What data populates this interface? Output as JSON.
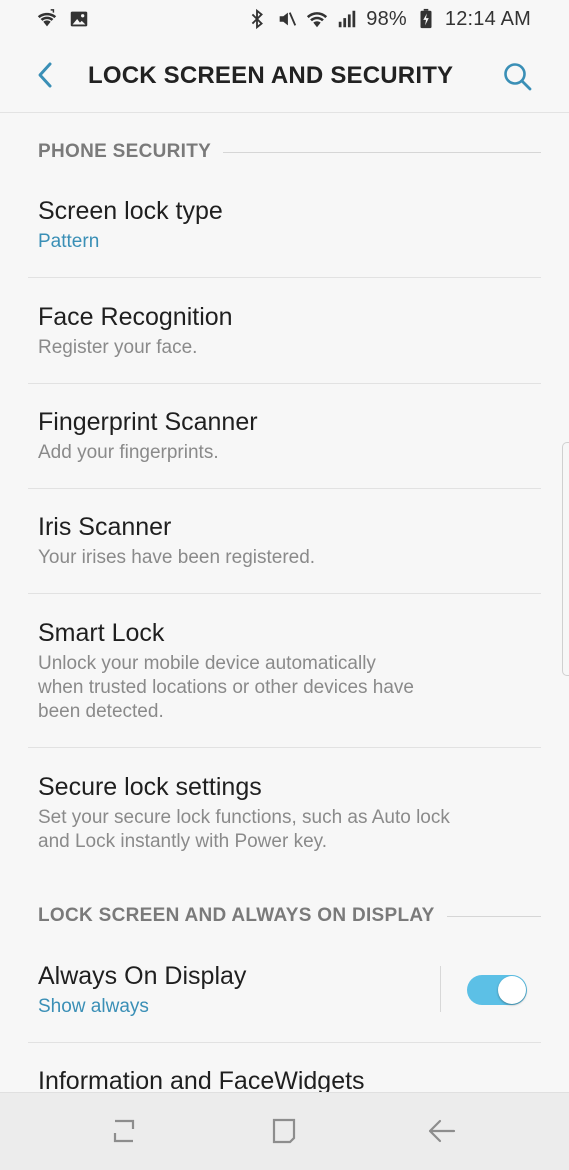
{
  "status_bar": {
    "icons_left": [
      "wifi-calling-icon",
      "image-icon"
    ],
    "icons_right": [
      "bluetooth-icon",
      "mute-icon",
      "wifi-icon",
      "signal-icon"
    ],
    "battery": "98%",
    "time": "12:14 AM"
  },
  "app_bar": {
    "title": "LOCK SCREEN AND SECURITY",
    "back_icon": "chevron-left-icon",
    "search_icon": "search-icon"
  },
  "sections": {
    "phone_security": "PHONE SECURITY",
    "lock_screen": "LOCK SCREEN AND ALWAYS ON DISPLAY"
  },
  "items": {
    "screen_lock": {
      "title": "Screen lock type",
      "subtitle": "Pattern"
    },
    "face": {
      "title": "Face Recognition",
      "subtitle": "Register your face."
    },
    "fingerprint": {
      "title": "Fingerprint Scanner",
      "subtitle": "Add your fingerprints."
    },
    "iris": {
      "title": "Iris Scanner",
      "subtitle": "Your irises have been registered."
    },
    "smart_lock": {
      "title": "Smart Lock",
      "subtitle_lines": [
        "Unlock your mobile device automatically",
        "when trusted locations or other devices have",
        "been detected."
      ]
    },
    "secure_lock": {
      "title": "Secure lock settings",
      "subtitle_lines": [
        "Set your secure lock functions, such as Auto lock",
        "and Lock instantly with Power key."
      ]
    },
    "aod": {
      "title": "Always On Display",
      "subtitle": "Show always",
      "toggle_on": true
    },
    "info_facewidgets": {
      "title": "Information and FaceWidgets"
    }
  },
  "colors": {
    "accent": "#3a8fb6",
    "toggle_on": "#5cc0e6",
    "background": "#f7f7f7"
  }
}
